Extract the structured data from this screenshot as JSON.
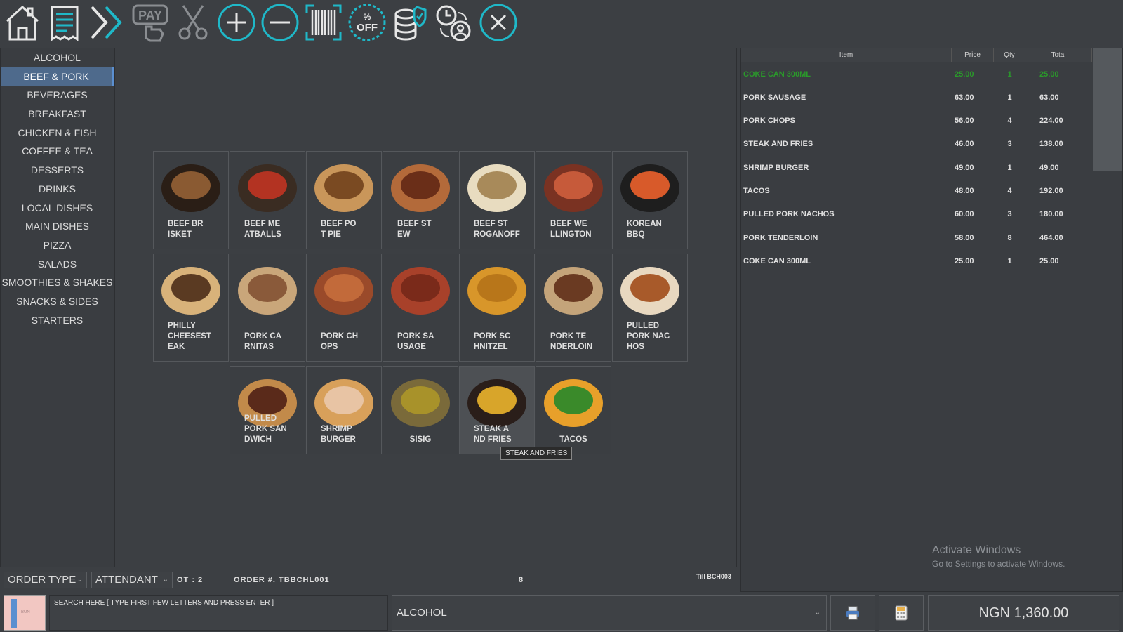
{
  "toolbar": {
    "buttons": [
      {
        "name": "home",
        "icon": "home-icon"
      },
      {
        "name": "receipt",
        "icon": "receipt-icon"
      },
      {
        "name": "forward",
        "icon": "double-chevron-right-icon"
      },
      {
        "name": "pay",
        "icon": "pay-icon",
        "label": "PAY"
      },
      {
        "name": "split",
        "icon": "scissors-icon"
      },
      {
        "name": "add",
        "icon": "plus-circle-icon"
      },
      {
        "name": "remove",
        "icon": "minus-circle-icon"
      },
      {
        "name": "barcode",
        "icon": "barcode-icon"
      },
      {
        "name": "discount",
        "icon": "discount-icon",
        "label": "% OFF"
      },
      {
        "name": "database",
        "icon": "database-shield-icon"
      },
      {
        "name": "shift",
        "icon": "clock-user-icon"
      },
      {
        "name": "close",
        "icon": "close-circle-icon"
      }
    ],
    "pay_label": "PAY",
    "discount_pct": "%",
    "discount_off": "OFF"
  },
  "categories": {
    "items": [
      "ALCOHOL",
      "BEEF & PORK",
      "BEVERAGES",
      "BREAKFAST",
      "CHICKEN & FISH",
      "COFFEE & TEA",
      "DESSERTS",
      "DRINKS",
      "LOCAL DISHES",
      "MAIN DISHES",
      "PIZZA",
      "SALADS",
      "SMOOTHIES & SHAKES",
      "SNACKS & SIDES",
      "STARTERS"
    ],
    "selected": "BEEF & PORK"
  },
  "products": [
    {
      "lines": [
        "BEEF BR",
        "ISKET"
      ],
      "icon": "beef-brisket-image"
    },
    {
      "lines": [
        "BEEF ME",
        "ATBALLS"
      ],
      "icon": "beef-meatballs-image"
    },
    {
      "lines": [
        "BEEF PO",
        "T PIE"
      ],
      "icon": "beef-pot-pie-image"
    },
    {
      "lines": [
        "BEEF ST",
        "EW"
      ],
      "icon": "beef-stew-image"
    },
    {
      "lines": [
        "BEEF ST",
        "ROGANOFF"
      ],
      "icon": "beef-stroganoff-image"
    },
    {
      "lines": [
        "BEEF WE",
        "LLINGTON"
      ],
      "icon": "beef-wellington-image"
    },
    {
      "lines": [
        "KOREAN",
        "BBQ"
      ],
      "icon": "korean-bbq-image"
    },
    {
      "lines": [
        "PHILLY",
        "CHEESEST",
        "EAK"
      ],
      "icon": "philly-cheesesteak-image"
    },
    {
      "lines": [
        "PORK CA",
        "RNITAS"
      ],
      "icon": "pork-carnitas-image"
    },
    {
      "lines": [
        "PORK CH",
        "OPS"
      ],
      "icon": "pork-chops-image"
    },
    {
      "lines": [
        "PORK SA",
        "USAGE"
      ],
      "icon": "pork-sausage-image"
    },
    {
      "lines": [
        "PORK SC",
        "HNITZEL"
      ],
      "icon": "pork-schnitzel-image"
    },
    {
      "lines": [
        "PORK TE",
        "NDERLOIN"
      ],
      "icon": "pork-tenderloin-image"
    },
    {
      "lines": [
        "PULLED",
        "PORK NAC",
        "HOS"
      ],
      "icon": "pulled-pork-nachos-image"
    },
    {
      "lines": [
        "PULLED",
        "PORK SAN",
        "DWICH"
      ],
      "icon": "pulled-pork-sandwich-image"
    },
    {
      "lines": [
        "SHRIMP",
        "BURGER"
      ],
      "icon": "shrimp-burger-image"
    },
    {
      "lines": [
        "SISIG"
      ],
      "icon": "sisig-image"
    },
    {
      "lines": [
        "STEAK A",
        "ND FRIES"
      ],
      "icon": "steak-fries-image"
    },
    {
      "lines": [
        "TACOS"
      ],
      "icon": "tacos-image"
    }
  ],
  "tooltip": "STEAK AND FRIES",
  "order": {
    "headers": {
      "item": "Item",
      "price": "Price",
      "qty": "Qty",
      "total": "Total"
    },
    "rows": [
      {
        "item": "COKE CAN 300ML",
        "price": "25.00",
        "qty": "1",
        "total": "25.00",
        "selected": true
      },
      {
        "item": "PORK SAUSAGE",
        "price": "63.00",
        "qty": "1",
        "total": "63.00"
      },
      {
        "item": "PORK CHOPS",
        "price": "56.00",
        "qty": "4",
        "total": "224.00"
      },
      {
        "item": "STEAK AND FRIES",
        "price": "46.00",
        "qty": "3",
        "total": "138.00"
      },
      {
        "item": "SHRIMP BURGER",
        "price": "49.00",
        "qty": "1",
        "total": "49.00"
      },
      {
        "item": "TACOS",
        "price": "48.00",
        "qty": "4",
        "total": "192.00"
      },
      {
        "item": "PULLED PORK NACHOS",
        "price": "60.00",
        "qty": "3",
        "total": "180.00"
      },
      {
        "item": "PORK TENDERLOIN",
        "price": "58.00",
        "qty": "8",
        "total": "464.00"
      },
      {
        "item": "COKE CAN 300ML",
        "price": "25.00",
        "qty": "1",
        "total": "25.00"
      }
    ]
  },
  "watermark": {
    "title": "Activate Windows",
    "subtitle": "Go to Settings to activate Windows."
  },
  "status": {
    "order_type": "ORDER TYPE",
    "attendant": "ATTENDANT",
    "ot": "OT :  2",
    "order_no": "ORDER #. TBBCHL001",
    "count": "8",
    "till": "Till  BCH003"
  },
  "bottom": {
    "thumb_text": "BUN",
    "search_placeholder": "SEARCH HERE [ TYPE FIRST FEW LETTERS AND PRESS ENTER ]",
    "category": "ALCOHOL",
    "total": "NGN 1,360.00"
  },
  "colors": {
    "accent": "#1fb8c8",
    "selected_row": "#2a9a2a",
    "selected_category": "#4e6a8c"
  }
}
